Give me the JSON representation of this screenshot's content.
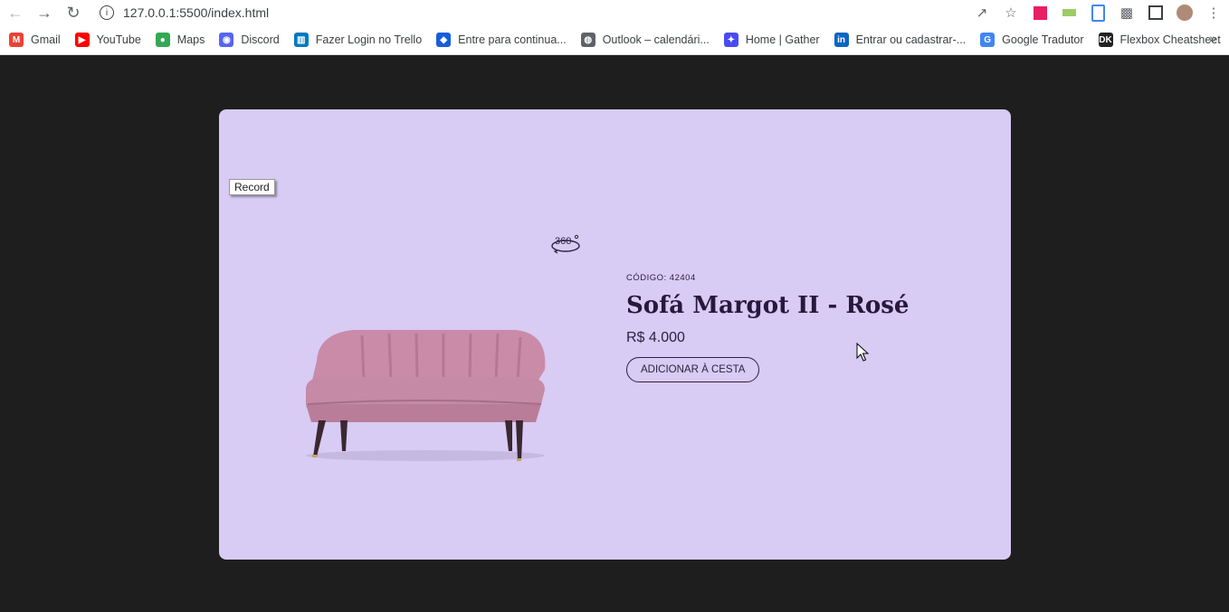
{
  "browser": {
    "url": "127.0.0.1:5500/index.html",
    "bookmarks": [
      {
        "label": "Gmail",
        "icon": "gmail-icon",
        "color": "#ea4335",
        "glyph": "M"
      },
      {
        "label": "YouTube",
        "icon": "youtube-icon",
        "color": "#ff0000",
        "glyph": "▶"
      },
      {
        "label": "Maps",
        "icon": "maps-icon",
        "color": "#34a853",
        "glyph": "●"
      },
      {
        "label": "Discord",
        "icon": "discord-icon",
        "color": "#5865f2",
        "glyph": "◉"
      },
      {
        "label": "Fazer Login no Trello",
        "icon": "trello-icon",
        "color": "#0079bf",
        "glyph": "▥"
      },
      {
        "label": "Entre para continua...",
        "icon": "bitwarden-icon",
        "color": "#175ddc",
        "glyph": "◆"
      },
      {
        "label": "Outlook – calendári...",
        "icon": "globe-icon",
        "color": "#5f6368",
        "glyph": "◍"
      },
      {
        "label": "Home | Gather",
        "icon": "gather-icon",
        "color": "#4a4af4",
        "glyph": "✦"
      },
      {
        "label": "Entrar ou cadastrar-...",
        "icon": "linkedin-icon",
        "color": "#0a66c2",
        "glyph": "in"
      },
      {
        "label": "Google Tradutor",
        "icon": "translate-icon",
        "color": "#4285f4",
        "glyph": "G"
      },
      {
        "label": "Flexbox Cheatsheet",
        "icon": "flexbox-icon",
        "color": "#222222",
        "glyph": "DK"
      }
    ]
  },
  "page": {
    "tooltip": "Record",
    "product": {
      "code": "CÓDIGO: 42404",
      "title": "Sofá Margot II - Rosé",
      "price": "R$ 4.000",
      "cta": "ADICIONAR À CESTA"
    },
    "colors": {
      "background": "#1e1e1e",
      "card": "#d8cbf4",
      "text": "#28183c"
    }
  }
}
